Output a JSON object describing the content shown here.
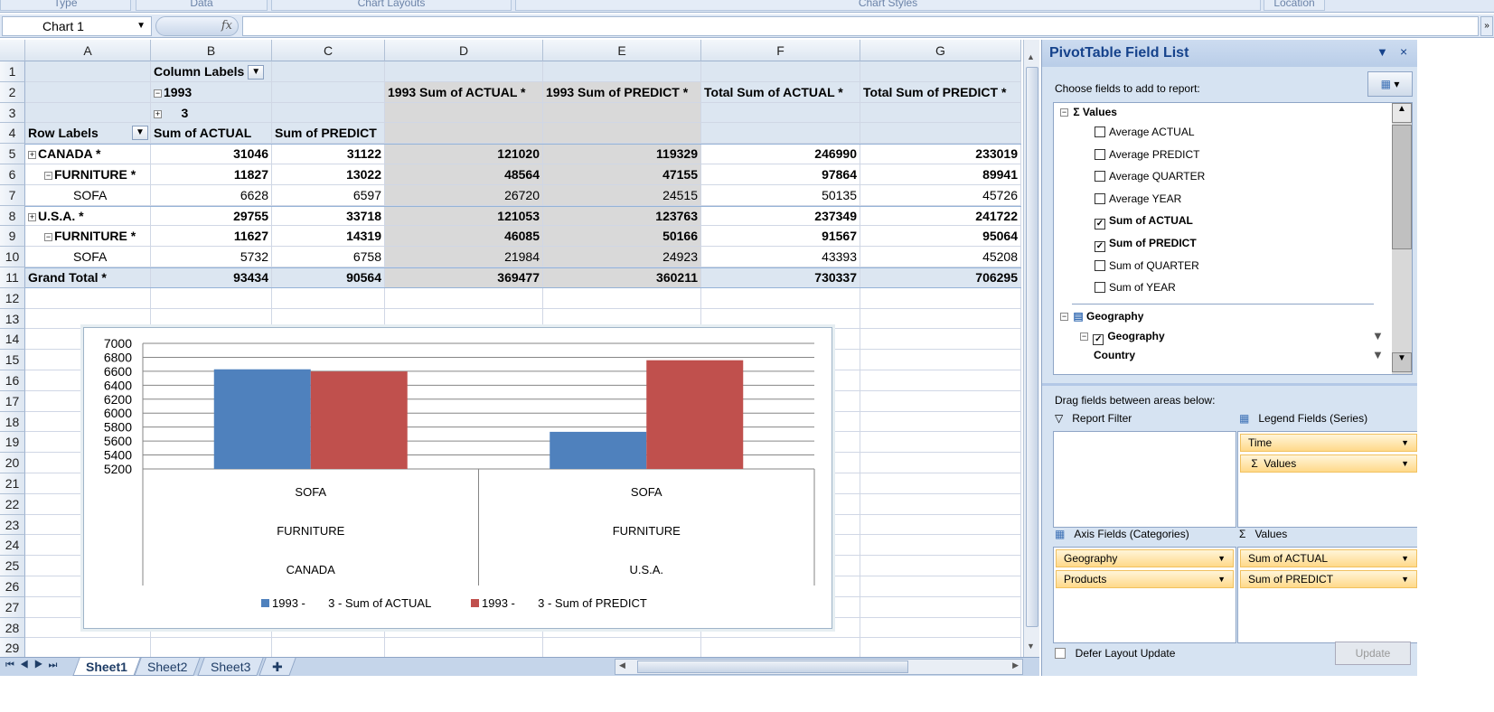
{
  "ribbon": {
    "groups": [
      "Type",
      "Data",
      "Chart Layouts",
      "Chart Styles",
      "Location"
    ]
  },
  "formula_bar": {
    "name_box": "Chart 1",
    "fx_label": "fx",
    "formula": ""
  },
  "columns": [
    "A",
    "B",
    "C",
    "D",
    "E",
    "F",
    "G"
  ],
  "row_numbers": [
    "1",
    "2",
    "3",
    "4",
    "5",
    "6",
    "7",
    "8",
    "9",
    "10",
    "11",
    "12",
    "13",
    "14",
    "15",
    "16",
    "17",
    "18",
    "19",
    "20",
    "21",
    "22",
    "23",
    "24",
    "25",
    "26",
    "27",
    "28",
    "29"
  ],
  "pivot": {
    "column_labels": "Column Labels",
    "year": "1993",
    "quarter": "3",
    "row_labels": "Row Labels",
    "headers": [
      "Sum of ACTUAL",
      "Sum of PREDICT",
      "1993 Sum of ACTUAL *",
      "1993 Sum of PREDICT *",
      "Total Sum of ACTUAL *",
      "Total Sum of PREDICT *"
    ],
    "rows": [
      {
        "label": "CANADA *",
        "toggle": "+",
        "level": 0,
        "bold": true,
        "values": [
          "31046",
          "31122",
          "121020",
          "119329",
          "246990",
          "233019"
        ]
      },
      {
        "label": "FURNITURE *",
        "toggle": "-",
        "level": 1,
        "bold": true,
        "values": [
          "11827",
          "13022",
          "48564",
          "47155",
          "97864",
          "89941"
        ]
      },
      {
        "label": "SOFA",
        "toggle": "",
        "level": 2,
        "bold": false,
        "values": [
          "6628",
          "6597",
          "26720",
          "24515",
          "50135",
          "45726"
        ]
      },
      {
        "label": "U.S.A. *",
        "toggle": "+",
        "level": 0,
        "bold": true,
        "values": [
          "29755",
          "33718",
          "121053",
          "123763",
          "237349",
          "241722"
        ]
      },
      {
        "label": "FURNITURE *",
        "toggle": "-",
        "level": 1,
        "bold": true,
        "values": [
          "11627",
          "14319",
          "46085",
          "50166",
          "91567",
          "95064"
        ]
      },
      {
        "label": "SOFA",
        "toggle": "",
        "level": 2,
        "bold": false,
        "values": [
          "5732",
          "6758",
          "21984",
          "24923",
          "43393",
          "45208"
        ]
      },
      {
        "label": "Grand Total *",
        "toggle": "",
        "level": 0,
        "bold": true,
        "values": [
          "93434",
          "90564",
          "369477",
          "360211",
          "730337",
          "706295"
        ]
      }
    ]
  },
  "chart_data": {
    "type": "bar",
    "categories": [
      [
        "SOFA",
        "FURNITURE",
        "CANADA"
      ],
      [
        "SOFA",
        "FURNITURE",
        "U.S.A."
      ]
    ],
    "series": [
      {
        "name": "1993 -       3 - Sum of ACTUAL",
        "color": "#4f81bd",
        "values": [
          6628,
          5732
        ]
      },
      {
        "name": "1993 -       3 - Sum of PREDICT",
        "color": "#c0504d",
        "values": [
          6597,
          6758
        ]
      }
    ],
    "ylim": [
      5200,
      7000
    ],
    "yticks": [
      "7000",
      "6800",
      "6600",
      "6400",
      "6200",
      "6000",
      "5800",
      "5600",
      "5400",
      "5200"
    ],
    "grid": true,
    "legend": "bottom"
  },
  "sheets": [
    "Sheet1",
    "Sheet2",
    "Sheet3"
  ],
  "active_sheet": "Sheet1",
  "field_list": {
    "title": "PivotTable Field List",
    "choose_label": "Choose fields to add to report:",
    "values_group": "Values",
    "fields": [
      {
        "label": "Average ACTUAL",
        "checked": false
      },
      {
        "label": "Average PREDICT",
        "checked": false
      },
      {
        "label": "Average QUARTER",
        "checked": false
      },
      {
        "label": "Average YEAR",
        "checked": false
      },
      {
        "label": "Sum of ACTUAL",
        "checked": true
      },
      {
        "label": "Sum of PREDICT",
        "checked": true
      },
      {
        "label": "Sum of QUARTER",
        "checked": false
      },
      {
        "label": "Sum of YEAR",
        "checked": false
      }
    ],
    "geography_group": "Geography",
    "geography_field": "Geography",
    "country": "Country",
    "drag_label": "Drag fields between areas below:",
    "report_filter": "Report Filter",
    "legend_fields": "Legend Fields (Series)",
    "legend_items": [
      "Time",
      "Values"
    ],
    "axis_fields": "Axis Fields (Categories)",
    "axis_items": [
      "Geography",
      "Products"
    ],
    "values_area": "Values",
    "values_items": [
      "Sum of ACTUAL",
      "Sum of PREDICT"
    ],
    "defer_label": "Defer Layout Update",
    "update_label": "Update"
  }
}
